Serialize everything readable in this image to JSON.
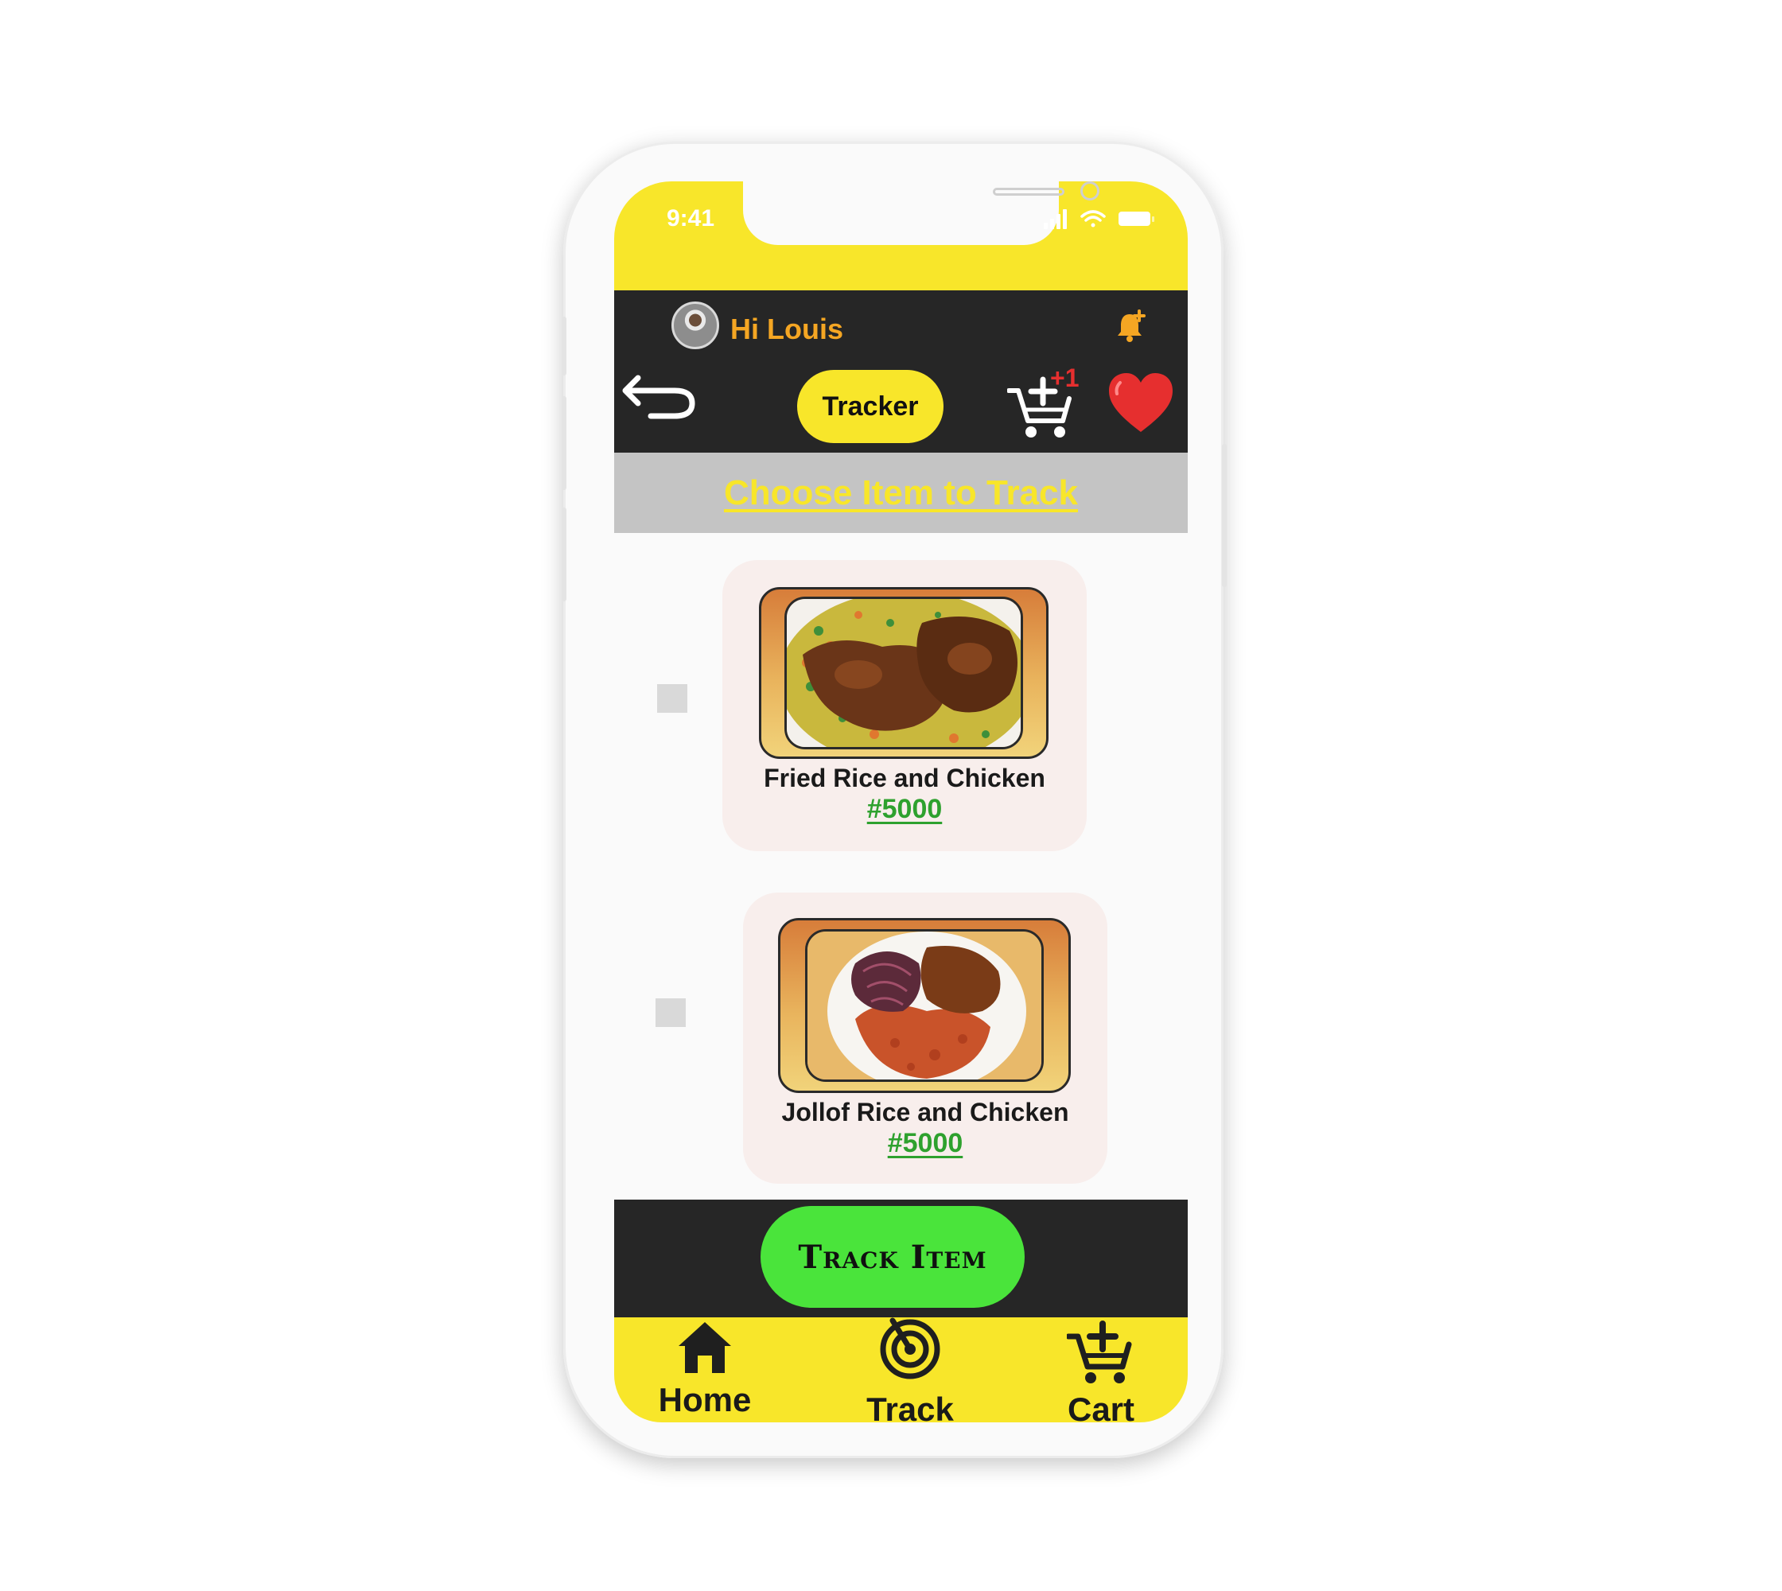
{
  "status_bar": {
    "time": "9:41"
  },
  "header": {
    "greeting": "Hi Louis",
    "tracker_label": "Tracker",
    "cart_badge": "+1"
  },
  "subheader": {
    "title": "Choose Item to Track"
  },
  "items": [
    {
      "name": "Fried Rice and Chicken",
      "price": "#5000"
    },
    {
      "name": "Jollof Rice and Chicken",
      "price": "#5000"
    }
  ],
  "action": {
    "track_label": "Track Item"
  },
  "tabbar": {
    "home_label": "Home",
    "track_label": "Track",
    "cart_label": "Cart"
  },
  "colors": {
    "accent_yellow": "#f8e62a",
    "dark": "#262626",
    "track_green": "#4ae43b",
    "price_green": "#2ea12e",
    "greeting_orange": "#f5a623",
    "heart_red": "#e62f2f"
  },
  "icons": [
    "bell-plus-icon",
    "back-arrow-icon",
    "cart-plus-icon",
    "heart-icon",
    "home-icon",
    "radar-icon",
    "cart-icon",
    "wifi-icon",
    "battery-icon",
    "signal-icon"
  ]
}
